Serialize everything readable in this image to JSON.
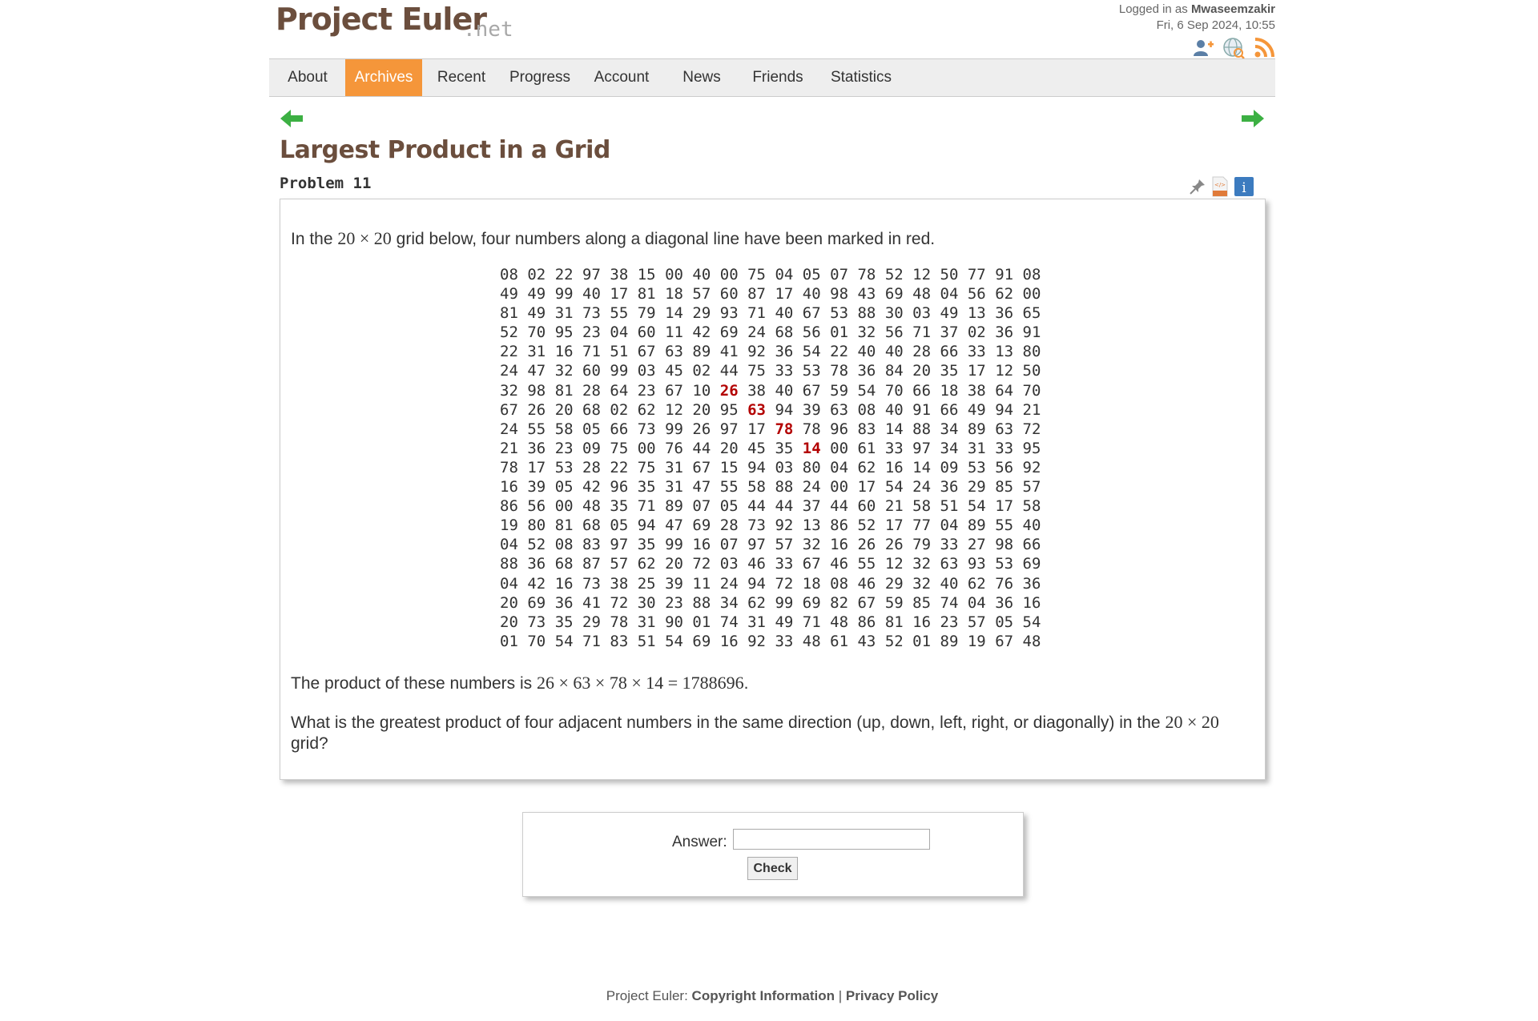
{
  "header": {
    "logo_main": "Project Euler",
    "logo_suffix": ".net",
    "logged_in_prefix": "Logged in as",
    "username": "Mwaseemzakir",
    "datetime": "Fri, 6 Sep 2024, 10:55",
    "icons": [
      "add-friend-icon",
      "globe-icon",
      "rss-icon"
    ]
  },
  "nav": {
    "items": [
      "About",
      "Archives",
      "Recent",
      "Progress",
      "Account",
      "News",
      "Friends",
      "Statistics"
    ],
    "active": "Archives",
    "active_color": "#f5963a"
  },
  "navigation_icons": [
    "previous-arrow-icon",
    "next-arrow-icon"
  ],
  "problem": {
    "title": "Largest Product in a Grid",
    "number_label": "Problem 11",
    "tool_icons": [
      "pin-icon",
      "code-icon",
      "info-icon"
    ],
    "intro_before": "In the",
    "intro_math": "20 × 20",
    "intro_after": "grid below, four numbers along a diagonal line have been marked in red.",
    "grid": [
      "08 02 22 97 38 15 00 40 00 75 04 05 07 78 52 12 50 77 91 08",
      "49 49 99 40 17 81 18 57 60 87 17 40 98 43 69 48 04 56 62 00",
      "81 49 31 73 55 79 14 29 93 71 40 67 53 88 30 03 49 13 36 65",
      "52 70 95 23 04 60 11 42 69 24 68 56 01 32 56 71 37 02 36 91",
      "22 31 16 71 51 67 63 89 41 92 36 54 22 40 40 28 66 33 13 80",
      "24 47 32 60 99 03 45 02 44 75 33 53 78 36 84 20 35 17 12 50",
      "32 98 81 28 64 23 67 10 26 38 40 67 59 54 70 66 18 38 64 70",
      "67 26 20 68 02 62 12 20 95 63 94 39 63 08 40 91 66 49 94 21",
      "24 55 58 05 66 73 99 26 97 17 78 78 96 83 14 88 34 89 63 72",
      "21 36 23 09 75 00 76 44 20 45 35 14 00 61 33 97 34 31 33 95",
      "78 17 53 28 22 75 31 67 15 94 03 80 04 62 16 14 09 53 56 92",
      "16 39 05 42 96 35 31 47 55 58 88 24 00 17 54 24 36 29 85 57",
      "86 56 00 48 35 71 89 07 05 44 44 37 44 60 21 58 51 54 17 58",
      "19 80 81 68 05 94 47 69 28 73 92 13 86 52 17 77 04 89 55 40",
      "04 52 08 83 97 35 99 16 07 97 57 32 16 26 26 79 33 27 98 66",
      "88 36 68 87 57 62 20 72 03 46 33 67 46 55 12 32 63 93 53 69",
      "04 42 16 73 38 25 39 11 24 94 72 18 08 46 29 32 40 62 76 36",
      "20 69 36 41 72 30 23 88 34 62 99 69 82 67 59 85 74 04 36 16",
      "20 73 35 29 78 31 90 01 74 31 49 71 48 86 81 16 23 57 05 54",
      "01 70 54 71 83 51 54 69 16 92 33 48 61 43 52 01 89 19 67 48"
    ],
    "highlighted": [
      [
        6,
        8
      ],
      [
        7,
        9
      ],
      [
        8,
        10
      ],
      [
        9,
        11
      ]
    ],
    "highlight_color": "#b30000",
    "product_before": "The product of these numbers is",
    "product_math": "26 × 63 × 78 × 14 = 1788696",
    "product_after": ".",
    "question_line1_before": "What is the greatest product of four adjacent numbers in the same direction (up, down, left, right, or diagonally) in the",
    "question_math": "20 × 20",
    "question_line2": "grid?"
  },
  "answer": {
    "label": "Answer:",
    "value": "",
    "button_label": "Check"
  },
  "footer": {
    "prefix": "Project Euler:",
    "copyright_link": "Copyright Information",
    "separator": "|",
    "privacy_link": "Privacy Policy"
  }
}
